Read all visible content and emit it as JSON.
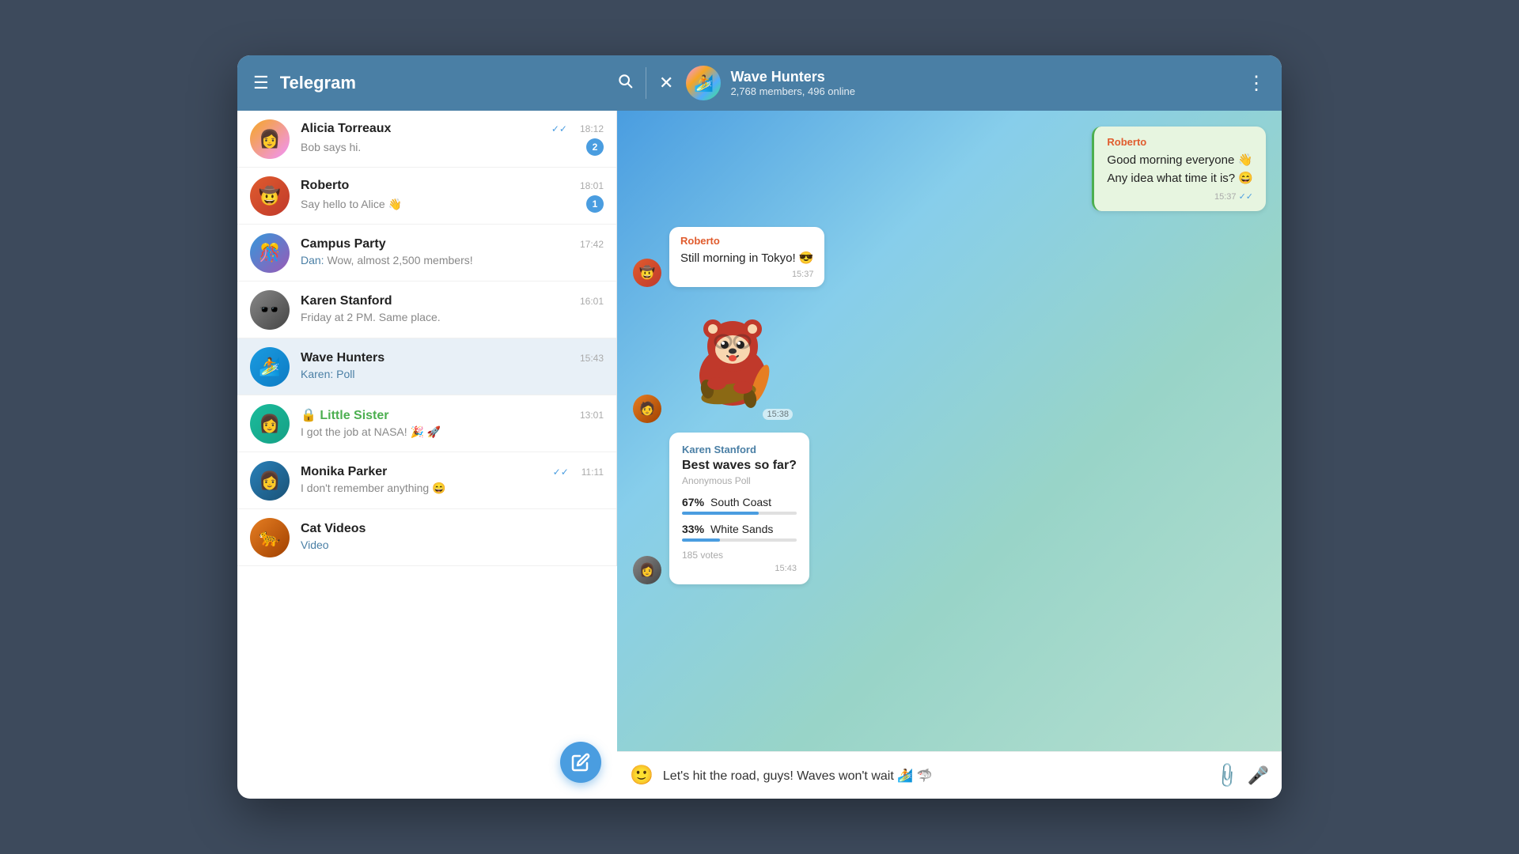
{
  "header": {
    "menu_icon": "☰",
    "title": "Telegram",
    "search_icon": "🔍",
    "close_icon": "✕",
    "chat": {
      "name": "Wave Hunters",
      "sub": "2,768 members, 496 online",
      "avatar_emoji": "🏄"
    },
    "more_icon": "⋮"
  },
  "sidebar": {
    "chats": [
      {
        "id": "alicia",
        "name": "Alicia Torreaux",
        "time": "18:12",
        "preview": "Bob says hi.",
        "badge": "2",
        "badge_color": "blue",
        "check": "✓",
        "avatar_emoji": "👩"
      },
      {
        "id": "roberto",
        "name": "Roberto",
        "time": "18:01",
        "preview": "Say hello to Alice 👋",
        "badge": "1",
        "badge_color": "blue",
        "avatar_emoji": "🤠"
      },
      {
        "id": "campus",
        "name": "Campus Party",
        "time": "17:42",
        "preview": "Dan: Wow, almost 2,500 members!",
        "preview_highlight": "Dan:",
        "avatar_emoji": "🎊"
      },
      {
        "id": "karen",
        "name": "Karen Stanford",
        "time": "16:01",
        "preview": "Friday at 2 PM. Same place.",
        "avatar_emoji": "🕶️"
      },
      {
        "id": "wave",
        "name": "Wave Hunters",
        "time": "15:43",
        "preview": "Karen: Poll",
        "preview_highlight": "Karen:",
        "active": true,
        "avatar_emoji": "🏄"
      },
      {
        "id": "sister",
        "name": "Little Sister",
        "time": "13:01",
        "preview": "I got the job at NASA! 🎉 🚀",
        "locked": true,
        "avatar_emoji": "👩"
      },
      {
        "id": "monika",
        "name": "Monika Parker",
        "time": "11:11",
        "preview": "I don't remember anything 😄",
        "check": "✓",
        "avatar_emoji": "👩"
      },
      {
        "id": "cat",
        "name": "Cat Videos",
        "time": "",
        "preview": "Video",
        "preview_highlight": "Video",
        "avatar_emoji": "🐆"
      }
    ],
    "fab_icon": "✏️"
  },
  "chat": {
    "messages": [
      {
        "id": "msg1",
        "type": "outgoing",
        "sender": "Roberto",
        "text": "Good morning everyone 👋\nAny idea what time it is? 😄",
        "time": "15:37",
        "check": "✓✓"
      },
      {
        "id": "msg2",
        "type": "incoming",
        "sender": "Roberto",
        "text": "Still morning in Tokyo! 😎",
        "time": "15:37"
      },
      {
        "id": "msg3",
        "type": "sticker",
        "time": "15:38",
        "emoji": "🦝"
      },
      {
        "id": "msg4",
        "type": "poll",
        "sender": "Karen Stanford",
        "question": "Best waves so far?",
        "poll_type": "Anonymous Poll",
        "options": [
          {
            "label": "South Coast",
            "pct": 67,
            "pct_label": "67%"
          },
          {
            "label": "White Sands",
            "pct": 33,
            "pct_label": "33%"
          }
        ],
        "votes": "185 votes",
        "time": "15:43"
      }
    ],
    "input_placeholder": "Let's hit the road, guys! Waves won't wait 🏄 🦈"
  }
}
